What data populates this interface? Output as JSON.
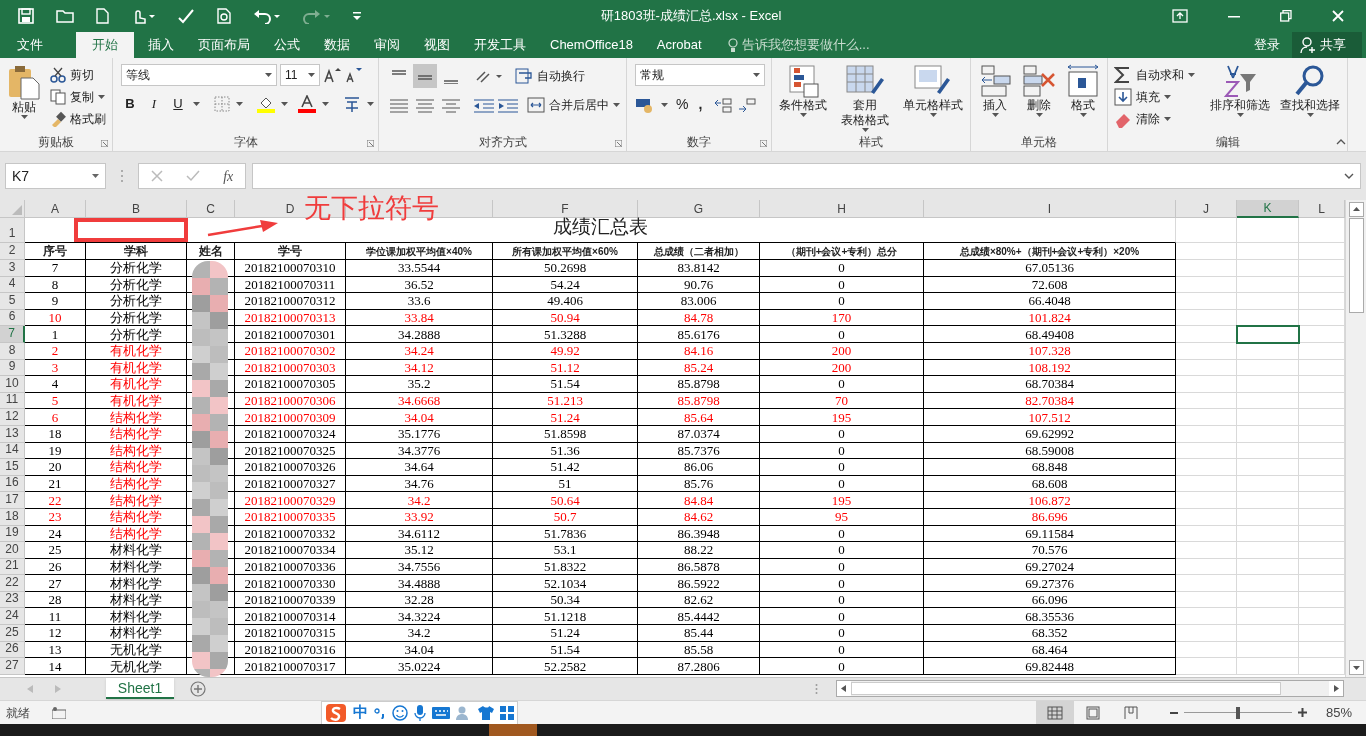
{
  "title_bar": {
    "title": "研1803班-成绩汇总.xlsx - Excel"
  },
  "menu_tabs": [
    {
      "label": "文件",
      "selected": false
    },
    {
      "label": "开始",
      "selected": true
    },
    {
      "label": "插入",
      "selected": false
    },
    {
      "label": "页面布局",
      "selected": false
    },
    {
      "label": "公式",
      "selected": false
    },
    {
      "label": "数据",
      "selected": false
    },
    {
      "label": "审阅",
      "selected": false
    },
    {
      "label": "视图",
      "selected": false
    },
    {
      "label": "开发工具",
      "selected": false
    },
    {
      "label": "ChemOffice18",
      "selected": false
    },
    {
      "label": "Acrobat",
      "selected": false
    }
  ],
  "tell_me": {
    "placeholder": "告诉我您想要做什么..."
  },
  "account": {
    "login": "登录",
    "share": "共享"
  },
  "clipboard": {
    "label": "剪贴板",
    "paste": "粘贴",
    "cut": "剪切",
    "copy": "复制",
    "format_painter": "格式刷"
  },
  "font": {
    "label": "字体",
    "font_name": "等线",
    "font_size": "11",
    "bold": "B",
    "italic": "I",
    "underline": "U"
  },
  "alignment": {
    "label": "对齐方式",
    "wrap_text": "自动换行",
    "merge_center": "合并后居中",
    "vertical_align": [
      {
        "selected": false
      },
      {
        "selected": true
      },
      {
        "selected": false
      }
    ]
  },
  "number": {
    "label": "数字",
    "format": "常规",
    "percent": "%",
    "comma": ","
  },
  "styles": {
    "label": "样式",
    "buttons": [
      {
        "lines": [
          "条件格式"
        ]
      },
      {
        "lines": [
          "套用",
          "表格格式"
        ]
      },
      {
        "lines": [
          "单元格样式"
        ]
      }
    ]
  },
  "cells": {
    "label": "单元格",
    "buttons": [
      "插入",
      "删除",
      "格式"
    ]
  },
  "editing": {
    "label": "编辑",
    "autosum": "自动求和",
    "fill": "填充",
    "clear": "清除",
    "sort_filter": "排序和筛选",
    "find_select": "查找和选择"
  },
  "formula_bar": {
    "name_box": "K7",
    "function_button": "fx"
  },
  "sheet": {
    "title": "成绩汇总表",
    "column_headers": [
      {
        "label": "A",
        "selected": false
      },
      {
        "label": "B",
        "selected": false
      },
      {
        "label": "C",
        "selected": false
      },
      {
        "label": "D",
        "selected": false
      },
      {
        "label": "F",
        "selected": false
      },
      {
        "label": "G",
        "selected": false
      },
      {
        "label": "H",
        "selected": false
      },
      {
        "label": "I",
        "selected": false
      },
      {
        "label": "J",
        "selected": false
      },
      {
        "label": "K",
        "selected": true
      },
      {
        "label": "L",
        "selected": false
      }
    ],
    "row_headers": [
      {
        "label": "1",
        "selected": false
      },
      {
        "label": "2",
        "selected": false
      },
      {
        "label": "3",
        "selected": false
      },
      {
        "label": "4",
        "selected": false
      },
      {
        "label": "5",
        "selected": false
      },
      {
        "label": "6",
        "selected": false
      },
      {
        "label": "7",
        "selected": true
      },
      {
        "label": "8",
        "selected": false
      },
      {
        "label": "9",
        "selected": false
      },
      {
        "label": "10",
        "selected": false
      },
      {
        "label": "11",
        "selected": false
      },
      {
        "label": "12",
        "selected": false
      },
      {
        "label": "13",
        "selected": false
      },
      {
        "label": "14",
        "selected": false
      },
      {
        "label": "15",
        "selected": false
      },
      {
        "label": "16",
        "selected": false
      },
      {
        "label": "17",
        "selected": false
      },
      {
        "label": "18",
        "selected": false
      },
      {
        "label": "19",
        "selected": false
      },
      {
        "label": "20",
        "selected": false
      },
      {
        "label": "21",
        "selected": false
      },
      {
        "label": "22",
        "selected": false
      },
      {
        "label": "23",
        "selected": false
      },
      {
        "label": "24",
        "selected": false
      },
      {
        "label": "25",
        "selected": false
      },
      {
        "label": "26",
        "selected": false
      },
      {
        "label": "27",
        "selected": false
      }
    ],
    "headers": [
      "序号",
      "学科",
      "姓名",
      "学号",
      "学位课加权平均值×40%",
      "所有课加权平均值×60%",
      "总成绩（二者相加）",
      "（期刊+会议+专利）总分",
      "总成绩×80%+（期刊+会议+专利）×20%"
    ],
    "names_redacted": true,
    "rows": [
      {
        "cells": [
          "7",
          "分析化学",
          "20182100070310",
          "33.5544",
          "50.2698",
          "83.8142",
          "0",
          "67.05136"
        ],
        "flagged": false,
        "subject_flagged": false
      },
      {
        "cells": [
          "8",
          "分析化学",
          "20182100070311",
          "36.52",
          "54.24",
          "90.76",
          "0",
          "72.608"
        ],
        "flagged": false,
        "subject_flagged": false
      },
      {
        "cells": [
          "9",
          "分析化学",
          "20182100070312",
          "33.6",
          "49.406",
          "83.006",
          "0",
          "66.4048"
        ],
        "flagged": false,
        "subject_flagged": false
      },
      {
        "cells": [
          "10",
          "分析化学",
          "20182100070313",
          "33.84",
          "50.94",
          "84.78",
          "170",
          "101.824"
        ],
        "flagged": true,
        "subject_flagged": false
      },
      {
        "cells": [
          "1",
          "分析化学",
          "20182100070301",
          "34.2888",
          "51.3288",
          "85.6176",
          "0",
          "68.49408"
        ],
        "flagged": false,
        "subject_flagged": false
      },
      {
        "cells": [
          "2",
          "有机化学",
          "20182100070302",
          "34.24",
          "49.92",
          "84.16",
          "200",
          "107.328"
        ],
        "flagged": true,
        "subject_flagged": true
      },
      {
        "cells": [
          "3",
          "有机化学",
          "20182100070303",
          "34.12",
          "51.12",
          "85.24",
          "200",
          "108.192"
        ],
        "flagged": true,
        "subject_flagged": true
      },
      {
        "cells": [
          "4",
          "有机化学",
          "20182100070305",
          "35.2",
          "51.54",
          "85.8798",
          "0",
          "68.70384"
        ],
        "flagged": false,
        "subject_flagged": true
      },
      {
        "cells": [
          "5",
          "有机化学",
          "20182100070306",
          "34.6668",
          "51.213",
          "85.8798",
          "70",
          "82.70384"
        ],
        "flagged": true,
        "subject_flagged": true
      },
      {
        "cells": [
          "6",
          "结构化学",
          "20182100070309",
          "34.04",
          "51.24",
          "85.64",
          "195",
          "107.512"
        ],
        "flagged": true,
        "subject_flagged": true
      },
      {
        "cells": [
          "18",
          "结构化学",
          "20182100070324",
          "35.1776",
          "51.8598",
          "87.0374",
          "0",
          "69.62992"
        ],
        "flagged": false,
        "subject_flagged": true
      },
      {
        "cells": [
          "19",
          "结构化学",
          "20182100070325",
          "34.3776",
          "51.36",
          "85.7376",
          "0",
          "68.59008"
        ],
        "flagged": false,
        "subject_flagged": true
      },
      {
        "cells": [
          "20",
          "结构化学",
          "20182100070326",
          "34.64",
          "51.42",
          "86.06",
          "0",
          "68.848"
        ],
        "flagged": false,
        "subject_flagged": true
      },
      {
        "cells": [
          "21",
          "结构化学",
          "20182100070327",
          "34.76",
          "51",
          "85.76",
          "0",
          "68.608"
        ],
        "flagged": false,
        "subject_flagged": true
      },
      {
        "cells": [
          "22",
          "结构化学",
          "20182100070329",
          "34.2",
          "50.64",
          "84.84",
          "195",
          "106.872"
        ],
        "flagged": true,
        "subject_flagged": true
      },
      {
        "cells": [
          "23",
          "结构化学",
          "20182100070335",
          "33.92",
          "50.7",
          "84.62",
          "95",
          "86.696"
        ],
        "flagged": true,
        "subject_flagged": true
      },
      {
        "cells": [
          "24",
          "结构化学",
          "20182100070332",
          "34.6112",
          "51.7836",
          "86.3948",
          "0",
          "69.11584"
        ],
        "flagged": false,
        "subject_flagged": true
      },
      {
        "cells": [
          "25",
          "材料化学",
          "20182100070334",
          "35.12",
          "53.1",
          "88.22",
          "0",
          "70.576"
        ],
        "flagged": false,
        "subject_flagged": false
      },
      {
        "cells": [
          "26",
          "材料化学",
          "20182100070336",
          "34.7556",
          "51.8322",
          "86.5878",
          "0",
          "69.27024"
        ],
        "flagged": false,
        "subject_flagged": false
      },
      {
        "cells": [
          "27",
          "材料化学",
          "20182100070330",
          "34.4888",
          "52.1034",
          "86.5922",
          "0",
          "69.27376"
        ],
        "flagged": false,
        "subject_flagged": false
      },
      {
        "cells": [
          "28",
          "材料化学",
          "20182100070339",
          "32.28",
          "50.34",
          "82.62",
          "0",
          "66.096"
        ],
        "flagged": false,
        "subject_flagged": false
      },
      {
        "cells": [
          "11",
          "材料化学",
          "20182100070314",
          "34.3224",
          "51.1218",
          "85.4442",
          "0",
          "68.35536"
        ],
        "flagged": false,
        "subject_flagged": false
      },
      {
        "cells": [
          "12",
          "材料化学",
          "20182100070315",
          "34.2",
          "51.24",
          "85.44",
          "0",
          "68.352"
        ],
        "flagged": false,
        "subject_flagged": false
      },
      {
        "cells": [
          "13",
          "无机化学",
          "20182100070316",
          "34.04",
          "51.54",
          "85.58",
          "0",
          "68.464"
        ],
        "flagged": false,
        "subject_flagged": false
      },
      {
        "cells": [
          "14",
          "无机化学",
          "20182100070317",
          "35.0224",
          "52.2582",
          "87.2806",
          "0",
          "69.82448"
        ],
        "flagged": false,
        "subject_flagged": false
      }
    ]
  },
  "annotation": {
    "text": "无下拉符号"
  },
  "sheet_tabs": [
    {
      "label": "Sheet1",
      "selected": true
    }
  ],
  "status_bar": {
    "text": "就绪",
    "ime": "中",
    "view_modes": [
      {
        "selected": true
      },
      {
        "selected": false
      },
      {
        "selected": false
      }
    ],
    "zoom_slider": {
      "level": 0.5
    },
    "zoom": "85%"
  }
}
